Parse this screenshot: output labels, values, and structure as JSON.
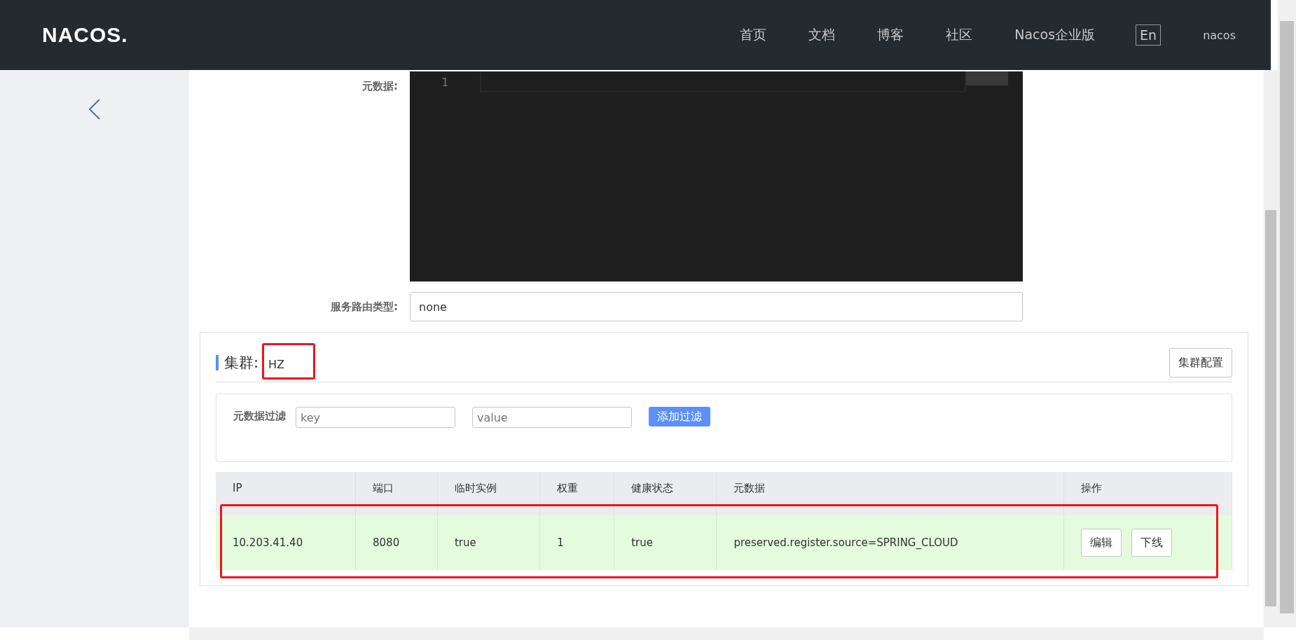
{
  "header": {
    "logo": "NACOS.",
    "nav": [
      {
        "label": "首页"
      },
      {
        "label": "文档"
      },
      {
        "label": "博客"
      },
      {
        "label": "社区"
      },
      {
        "label": "Nacos企业版"
      }
    ],
    "language": "En",
    "user": "nacos"
  },
  "form": {
    "metadata_label": "元数据:",
    "editor_line": "1",
    "routing_label": "服务路由类型:",
    "routing_value": "none"
  },
  "cluster": {
    "title": "集群:",
    "name": "HZ",
    "config_button": "集群配置",
    "filter": {
      "label": "元数据过滤",
      "key_placeholder": "key",
      "value_placeholder": "value",
      "add_button": "添加过滤"
    },
    "table": {
      "columns": [
        "IP",
        "端口",
        "临时实例",
        "权重",
        "健康状态",
        "元数据",
        "操作"
      ],
      "rows": [
        {
          "cells": [
            "10.203.41.40",
            "8080",
            "true",
            "1",
            "true",
            "preserved.register.source=SPRING_CLOUD"
          ],
          "actions": [
            "编辑",
            "下线"
          ]
        }
      ]
    }
  }
}
